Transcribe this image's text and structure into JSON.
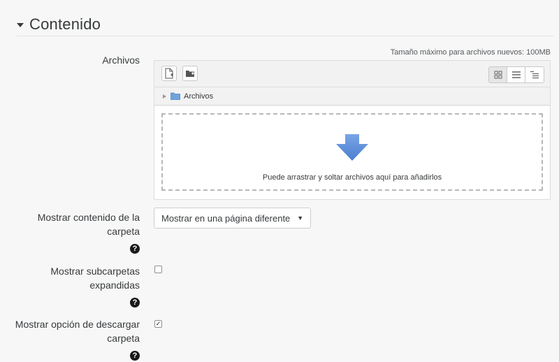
{
  "section": {
    "title": "Contenido"
  },
  "archivos": {
    "label": "Archivos",
    "max_size": "Tamaño máximo para archivos nuevos: 100MB",
    "path": "Archivos",
    "drop_text": "Puede arrastrar y soltar archivos aquí para añadirlos"
  },
  "mostrar_contenido": {
    "label_line1": "Mostrar contenido de la",
    "label_line2": "carpeta",
    "selected": "Mostrar en una página diferente"
  },
  "subcarpetas": {
    "label_line1": "Mostrar subcarpetas",
    "label_line2": "expandidas",
    "checked": false
  },
  "descargar": {
    "label_line1": "Mostrar opción de descargar",
    "label_line2": "carpeta",
    "checked": true
  },
  "icons": {
    "help": "?",
    "check": "✓"
  },
  "colors": {
    "drop_arrow": "#5b8bd6",
    "folder": "#6fa3db"
  }
}
